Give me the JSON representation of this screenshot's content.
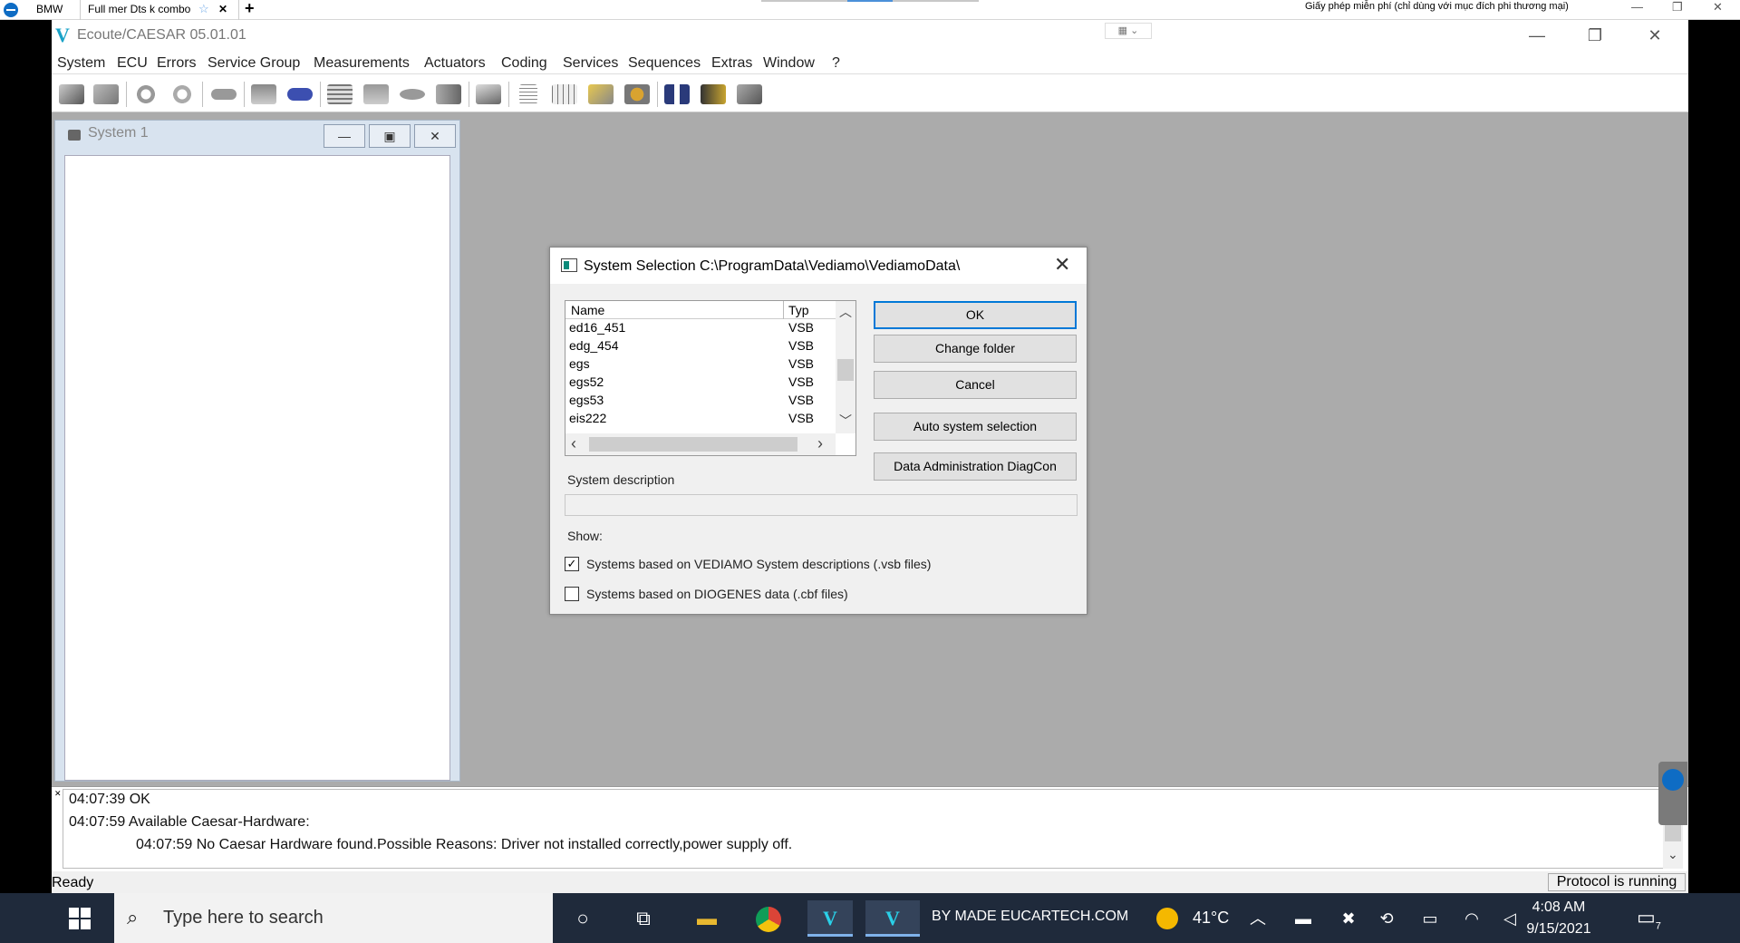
{
  "topbar": {
    "tab1": "BMW",
    "tab2": "Full mer Dts k combo",
    "license": "Giấy phép miễn phí (chỉ dùng với mục đích phi thương mại)"
  },
  "window": {
    "title": "Ecoute/CAESAR 05.01.01"
  },
  "menu": [
    "System",
    "ECU",
    "Errors",
    "Service Group",
    "Measurements",
    "Actuators",
    "Coding",
    "Services",
    "Sequences",
    "Extras",
    "Window",
    "?"
  ],
  "mdi": {
    "title": "System 1"
  },
  "dialog": {
    "title": "System Selection  C:\\ProgramData\\Vediamo\\VediamoData\\",
    "columns": {
      "name": "Name",
      "type": "Typ"
    },
    "rows": [
      {
        "name": "ed16_451",
        "type": "VSB"
      },
      {
        "name": "edg_454",
        "type": "VSB"
      },
      {
        "name": "egs",
        "type": "VSB"
      },
      {
        "name": "egs52",
        "type": "VSB"
      },
      {
        "name": "egs53",
        "type": "VSB"
      },
      {
        "name": "eis222",
        "type": "VSB"
      }
    ],
    "buttons": {
      "ok": "OK",
      "change_folder": "Change folder",
      "cancel": "Cancel",
      "auto": "Auto system selection",
      "data_admin": "Data Administration DiagCon"
    },
    "system_description_label": "System description",
    "show_label": "Show:",
    "check_vsb": {
      "label": "Systems based on VEDIAMO System descriptions (.vsb files)",
      "checked": true
    },
    "check_cbf": {
      "label": "Systems based on DIOGENES data (.cbf files)",
      "checked": false
    }
  },
  "log": [
    "04:07:39 OK",
    "04:07:59 Available Caesar-Hardware:",
    "04:07:59 No Caesar Hardware found.Possible Reasons: Driver not installed correctly,power supply off."
  ],
  "status": {
    "left": "Ready",
    "right": "Protocol is running"
  },
  "taskbar": {
    "search_placeholder": "Type here to search",
    "label": "BY MADE EUCARTECH.COM",
    "temperature": "41°C",
    "time": "4:08 AM",
    "date": "9/15/2021",
    "notifications": "7"
  },
  "colors": {
    "accent": "#0078d7",
    "workspace": "#ababab",
    "taskbar": "#1f2a3b"
  }
}
